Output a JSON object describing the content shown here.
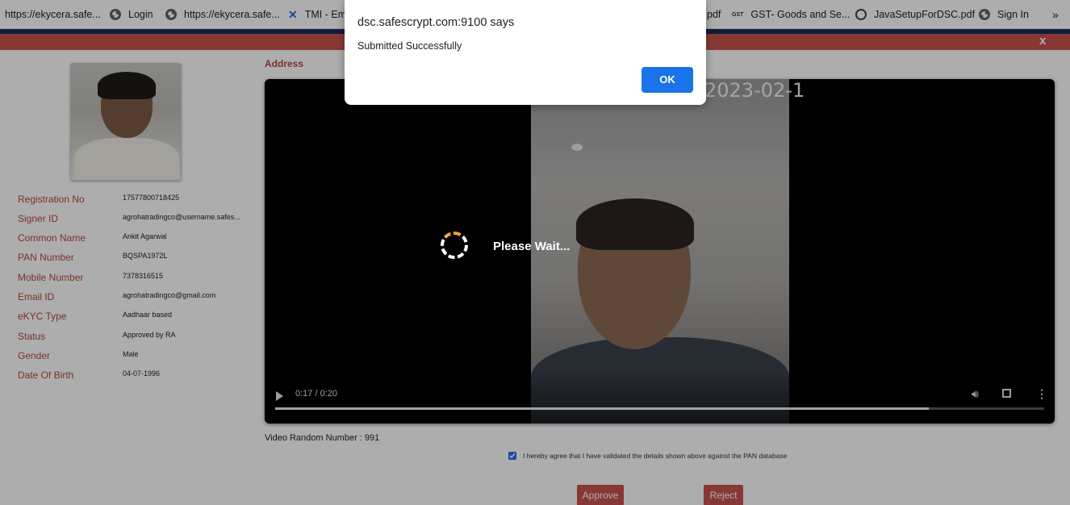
{
  "bookmarks": {
    "items": [
      {
        "label": "https://ekycera.safe...",
        "icon": "none"
      },
      {
        "label": "Login",
        "icon": "globe-icon"
      },
      {
        "label": "https://ekycera.safe...",
        "icon": "globe-icon"
      },
      {
        "label": "TMI - Em",
        "icon": "x-icon"
      },
      {
        "label": "pdf",
        "icon": "none"
      },
      {
        "label": "GST- Goods and Se...",
        "icon": "gst-icon"
      },
      {
        "label": "JavaSetupForDSC.pdf",
        "icon": "gov-icon"
      },
      {
        "label": "Sign In",
        "icon": "globe-icon"
      }
    ],
    "overflow": "»"
  },
  "modal": {
    "close": "x"
  },
  "profile": {
    "fields": [
      {
        "label": "Registration No",
        "value": "17577800718425"
      },
      {
        "label": "Signer ID",
        "value": "agrohatradingco@username.safes..."
      },
      {
        "label": "Common Name",
        "value": "Ankit Agarwal"
      },
      {
        "label": "PAN Number",
        "value": "BQSPA1972L"
      },
      {
        "label": "Mobile Number",
        "value": "7378316515"
      },
      {
        "label": "Email ID",
        "value": "agrohatradingco@gmail.com"
      },
      {
        "label": "eKYC Type",
        "value": "Aadhaar based"
      },
      {
        "label": "Status",
        "value": "Approved by RA"
      },
      {
        "label": "Gender",
        "value": "Male"
      },
      {
        "label": "Date Of Birth",
        "value": "04-07-1996"
      }
    ]
  },
  "address_label": "Address",
  "video": {
    "timestamp": "2023-02-1",
    "time": "0:17 / 0:20",
    "progress": 0.85,
    "random_number_label": "Video Random Number : 991"
  },
  "agreement": {
    "text": "I hereby agree that I have validated the details shown above against the PAN database",
    "checked": true
  },
  "actions": {
    "approve": "Approve",
    "reject": "Reject"
  },
  "loading": {
    "text": "Please Wait..."
  },
  "alert": {
    "title": "dsc.safescrypt.com:9100 says",
    "message": "Submitted Successfully",
    "ok": "OK"
  },
  "colors": {
    "accent_red": "#c9534d",
    "label_red": "#b24a44",
    "dialog_button_blue": "#1a73e8"
  }
}
